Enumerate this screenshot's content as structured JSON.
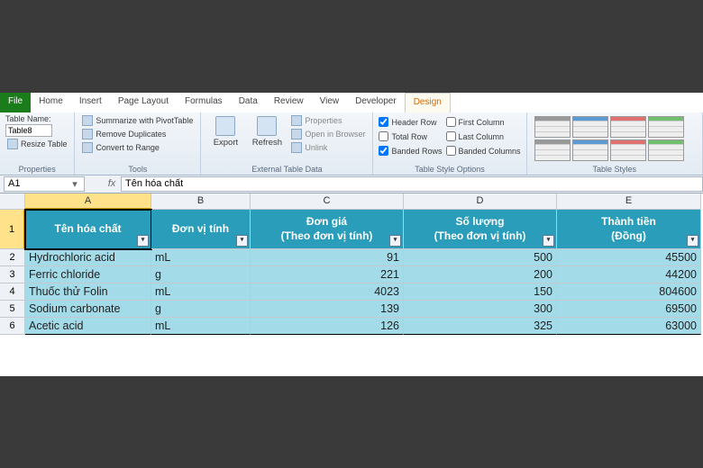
{
  "tabs": {
    "file": "File",
    "items": [
      "Home",
      "Insert",
      "Page Layout",
      "Formulas",
      "Data",
      "Review",
      "View",
      "Developer"
    ],
    "active": "Design"
  },
  "ribbon": {
    "properties": {
      "label": "Table Name:",
      "value": "Table8",
      "resize": "Resize Table",
      "title": "Properties"
    },
    "tools": {
      "items": [
        "Summarize with PivotTable",
        "Remove Duplicates",
        "Convert to Range"
      ],
      "title": "Tools"
    },
    "external": {
      "export": "Export",
      "refresh": "Refresh",
      "items": [
        "Properties",
        "Open in Browser",
        "Unlink"
      ],
      "title": "External Table Data"
    },
    "options": {
      "col1": [
        {
          "label": "Header Row",
          "checked": true
        },
        {
          "label": "Total Row",
          "checked": false
        },
        {
          "label": "Banded Rows",
          "checked": true
        }
      ],
      "col2": [
        {
          "label": "First Column",
          "checked": false
        },
        {
          "label": "Last Column",
          "checked": false
        },
        {
          "label": "Banded Columns",
          "checked": false
        }
      ],
      "title": "Table Style Options"
    },
    "styles": {
      "title": "Table Styles"
    }
  },
  "formula_bar": {
    "name": "A1",
    "formula": "Tên hóa chất"
  },
  "columns": [
    "A",
    "B",
    "C",
    "D",
    "E"
  ],
  "rows": [
    1,
    2,
    3,
    4,
    5,
    6
  ],
  "header": {
    "A": "Tên hóa chất",
    "B": "Đơn vị tính",
    "C1": "Đơn giá",
    "C2": "(Theo đơn vị tính)",
    "D1": "Số lượng",
    "D2": "(Theo đơn vị tính)",
    "E1": "Thành tiền",
    "E2": "(Đồng)"
  },
  "data": [
    {
      "a": "Hydrochloric acid",
      "b": "mL",
      "c": "91",
      "d": "500",
      "e": "45500"
    },
    {
      "a": "Ferric chloride",
      "b": "g",
      "c": "221",
      "d": "200",
      "e": "44200"
    },
    {
      "a": "Thuốc thử Folin",
      "b": "mL",
      "c": "4023",
      "d": "150",
      "e": "804600"
    },
    {
      "a": "Sodium carbonate",
      "b": "g",
      "c": "139",
      "d": "300",
      "e": "69500"
    },
    {
      "a": "Acetic acid",
      "b": "mL",
      "c": "126",
      "d": "325",
      "e": "63000"
    }
  ]
}
